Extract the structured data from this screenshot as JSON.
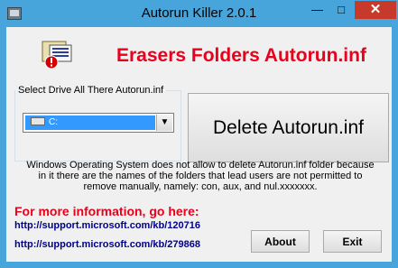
{
  "window": {
    "title": "Autorun Killer 2.0.1",
    "minimize_glyph": "—",
    "maximize_glyph": "□",
    "close_glyph": "✕"
  },
  "header": {
    "headline": "Erasers Folders Autorun.inf",
    "logo_icon": "folder-warning-icon"
  },
  "drive_group": {
    "label": "Select Drive All There Autorun.inf",
    "selected_drive": "C:",
    "drive_icon": "hard-drive-icon",
    "dropdown_icon": "chevron-down-icon"
  },
  "actions": {
    "delete_label": "Delete Autorun.inf",
    "about_label": "About",
    "exit_label": "Exit"
  },
  "notice": {
    "line1": "Windows Operating System does not allow to delete Autorun.inf folder because",
    "line2": "in it there are the names of the folders that lead users are not permitted to",
    "line3": "remove manually, namely: con, aux, and nul.xxxxxxx."
  },
  "info": {
    "heading": "For more information, go here:",
    "link1": "http://support.microsoft.com/kb/120716",
    "link2": "http://support.microsoft.com/kb/279868"
  },
  "colors": {
    "frame": "#47a5dc",
    "accent_red": "#e8001c",
    "link_blue": "#00008b",
    "selection": "#3399ff"
  }
}
